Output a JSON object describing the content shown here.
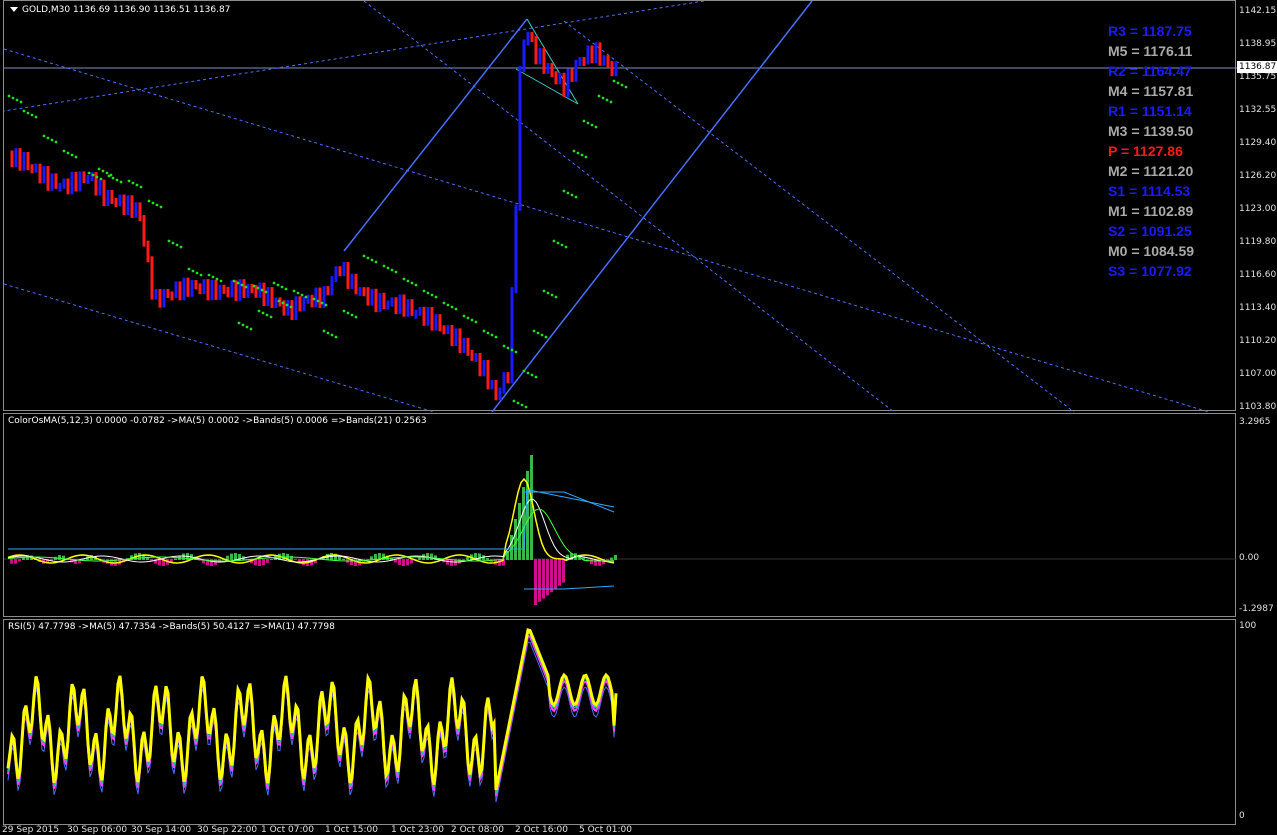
{
  "symbol_header": "GOLD,M30  1136.69 1136.90 1136.51 1136.87",
  "price_axis": [
    "1142.15",
    "1138.95",
    "1135.75",
    "1132.55",
    "1129.40",
    "1126.20",
    "1123.00",
    "1119.80",
    "1116.60",
    "1113.40",
    "1110.20",
    "1107.00",
    "1103.80"
  ],
  "current_price": "1136.87",
  "pivots": [
    {
      "label": "R3 = 1187.75",
      "color": "#1a1aff"
    },
    {
      "label": "M5 = 1176.11",
      "color": "#a9a9a9"
    },
    {
      "label": "R2 = 1164.47",
      "color": "#1a1aff"
    },
    {
      "label": "M4 = 1157.81",
      "color": "#a9a9a9"
    },
    {
      "label": "R1 = 1151.14",
      "color": "#1a1aff"
    },
    {
      "label": "M3 = 1139.50",
      "color": "#a9a9a9"
    },
    {
      "label": "P  = 1127.86",
      "color": "#ff1a1a"
    },
    {
      "label": "M2 = 1121.20",
      "color": "#a9a9a9"
    },
    {
      "label": "S1 = 1114.53",
      "color": "#1a1aff"
    },
    {
      "label": "M1 = 1102.89",
      "color": "#a9a9a9"
    },
    {
      "label": "S2 = 1091.25",
      "color": "#1a1aff"
    },
    {
      "label": "M0 = 1084.59",
      "color": "#a9a9a9"
    },
    {
      "label": "S3 = 1077.92",
      "color": "#1a1aff"
    }
  ],
  "osma_panel": {
    "title": "ColorOsMA(5,12,3) 0.0000 -0.0782  ->MA(5) 0.0002  ->Bands(5) 0.0006  =>Bands(21) 0.2563",
    "axis": [
      "3.2965",
      "0.00",
      "-1.2987"
    ]
  },
  "rsi_panel": {
    "title": "RSI(5) 47.7798  ->MA(5) 47.7354  ->Bands(5) 50.4127  =>MA(1) 47.7798",
    "axis": [
      "100",
      "0"
    ]
  },
  "time_axis": [
    "29 Sep 2015",
    "30 Sep 06:00",
    "30 Sep 14:00",
    "30 Sep 22:00",
    "1 Oct 07:00",
    "1 Oct 15:00",
    "1 Oct 23:00",
    "2 Oct 08:00",
    "2 Oct 16:00",
    "5 Oct 01:00"
  ],
  "colors": {
    "bull": "#1a1aff",
    "bear": "#ff1a1a",
    "psar": "#22dd22",
    "channel": "#4a6fff",
    "rsi": "#ffff00"
  }
}
